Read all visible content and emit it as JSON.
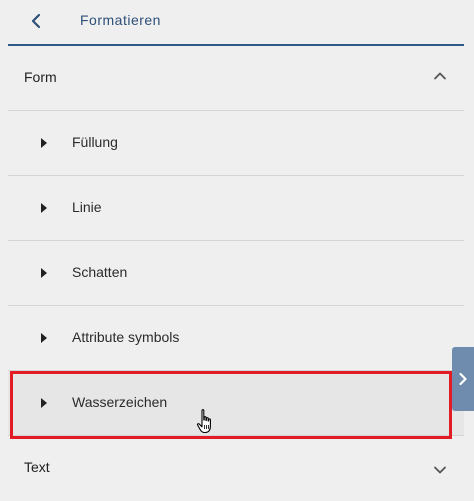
{
  "header": {
    "back_icon": "chevron-left-icon",
    "title": "Formatieren"
  },
  "sections": {
    "form": {
      "label": "Form",
      "expanded": true,
      "items": [
        {
          "label": "Füllung"
        },
        {
          "label": "Linie"
        },
        {
          "label": "Schatten"
        },
        {
          "label": "Attribute symbols"
        },
        {
          "label": "Wasserzeichen"
        }
      ]
    },
    "text": {
      "label": "Text",
      "expanded": false
    }
  },
  "colors": {
    "accent": "#2e5a8a",
    "highlight": "#e21b24",
    "side_tab": "#6f8cae",
    "background": "#efefef"
  }
}
